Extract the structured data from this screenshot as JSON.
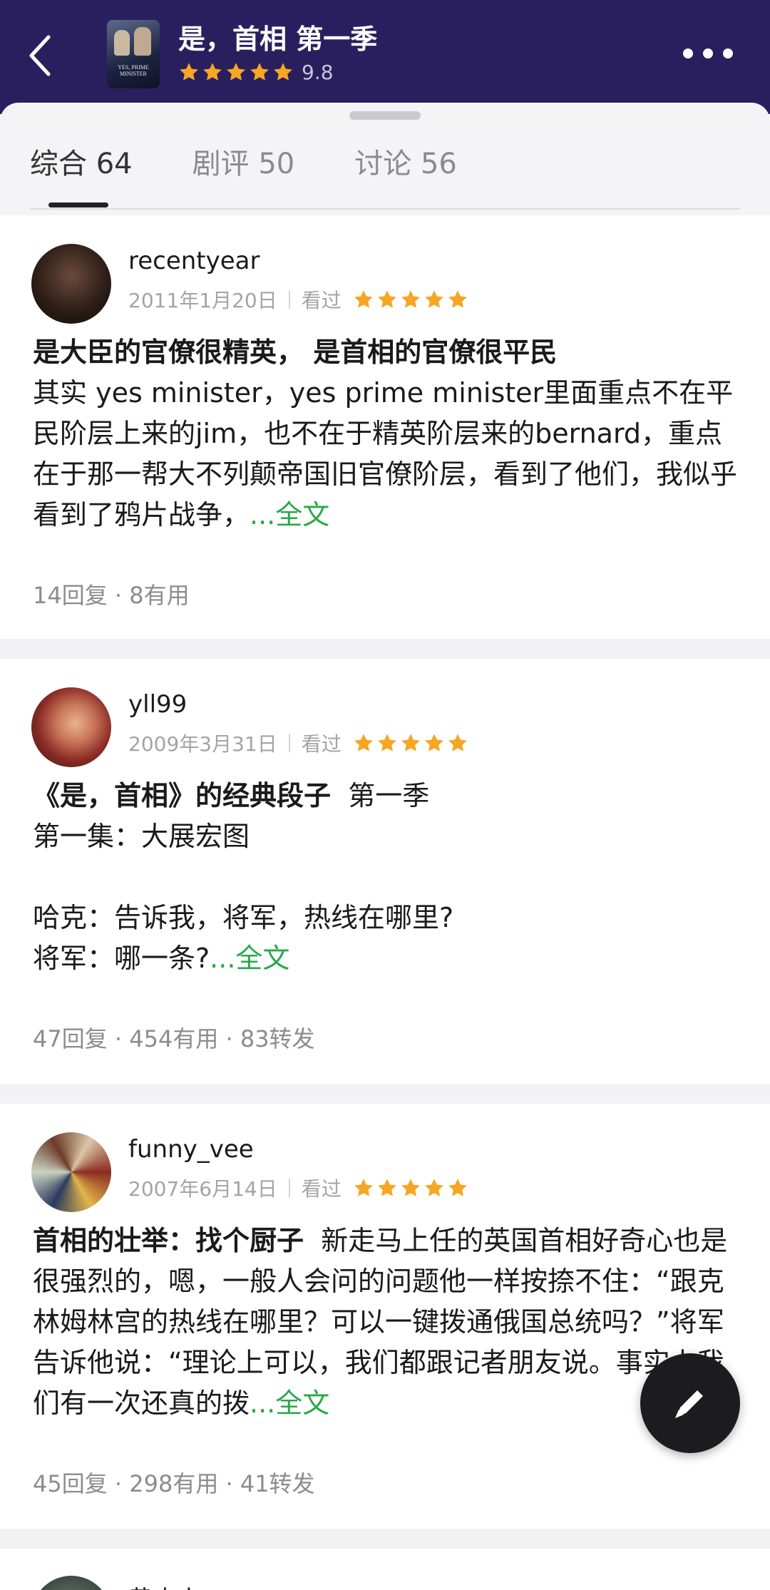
{
  "header": {
    "title": "是，首相 第一季",
    "rating": "9.8",
    "poster_text": "YES, PRIME MINISTER",
    "back_icon": "chevron-left-icon",
    "more_icon": "more-horizontal-icon",
    "colors": {
      "background": "#2a1f5e",
      "star": "#f5a623"
    }
  },
  "tabs": [
    {
      "label": "综合 64",
      "active": true
    },
    {
      "label": "剧评 50",
      "active": false
    },
    {
      "label": "讨论 56",
      "active": false
    }
  ],
  "reviews": [
    {
      "username": "recentyear",
      "date": "2011年1月20日",
      "status": "看过",
      "stars": 5,
      "title": "是大臣的官僚很精英， 是首相的官僚很平民",
      "excerpt": "其实 yes minister，yes prime minister里面重点不在平民阶层上来的jim，也不在于精英阶层来的bernard，重点在于那一帮大不列颠帝国旧官僚阶层，看到了他们，我似乎看到了鸦片战争，",
      "more": "...全文",
      "stats": "14回复 · 8有用"
    },
    {
      "username": "yll99",
      "date": "2009年3月31日",
      "status": "看过",
      "stars": 5,
      "title": "《是，首相》的经典段子",
      "title_suffix": "第一季",
      "lines": [
        "第一集：大展宏图",
        "",
        "哈克：告诉我，将军，热线在哪里?"
      ],
      "last_line": "将军：哪一条?",
      "more": "...全文",
      "stats": "47回复 · 454有用 · 83转发"
    },
    {
      "username": "funny_vee",
      "date": "2007年6月14日",
      "status": "看过",
      "stars": 5,
      "title": "首相的壮举：找个厨子",
      "excerpt": "新走马上任的英国首相好奇心也是很强烈的，嗯，一般人会问的问题他一样按捺不住：“跟克林姆林宫的热线在哪里？可以一键拨通俄国总统吗？”将军告诉他说：“理论上可以，我们都跟记者朋友说。事实上我们有一次还真的拨",
      "more": "...全文",
      "stats": "45回复 · 298有用 · 41转发"
    },
    {
      "username": "黄肉人"
    }
  ],
  "fab": {
    "icon": "pen-icon"
  }
}
